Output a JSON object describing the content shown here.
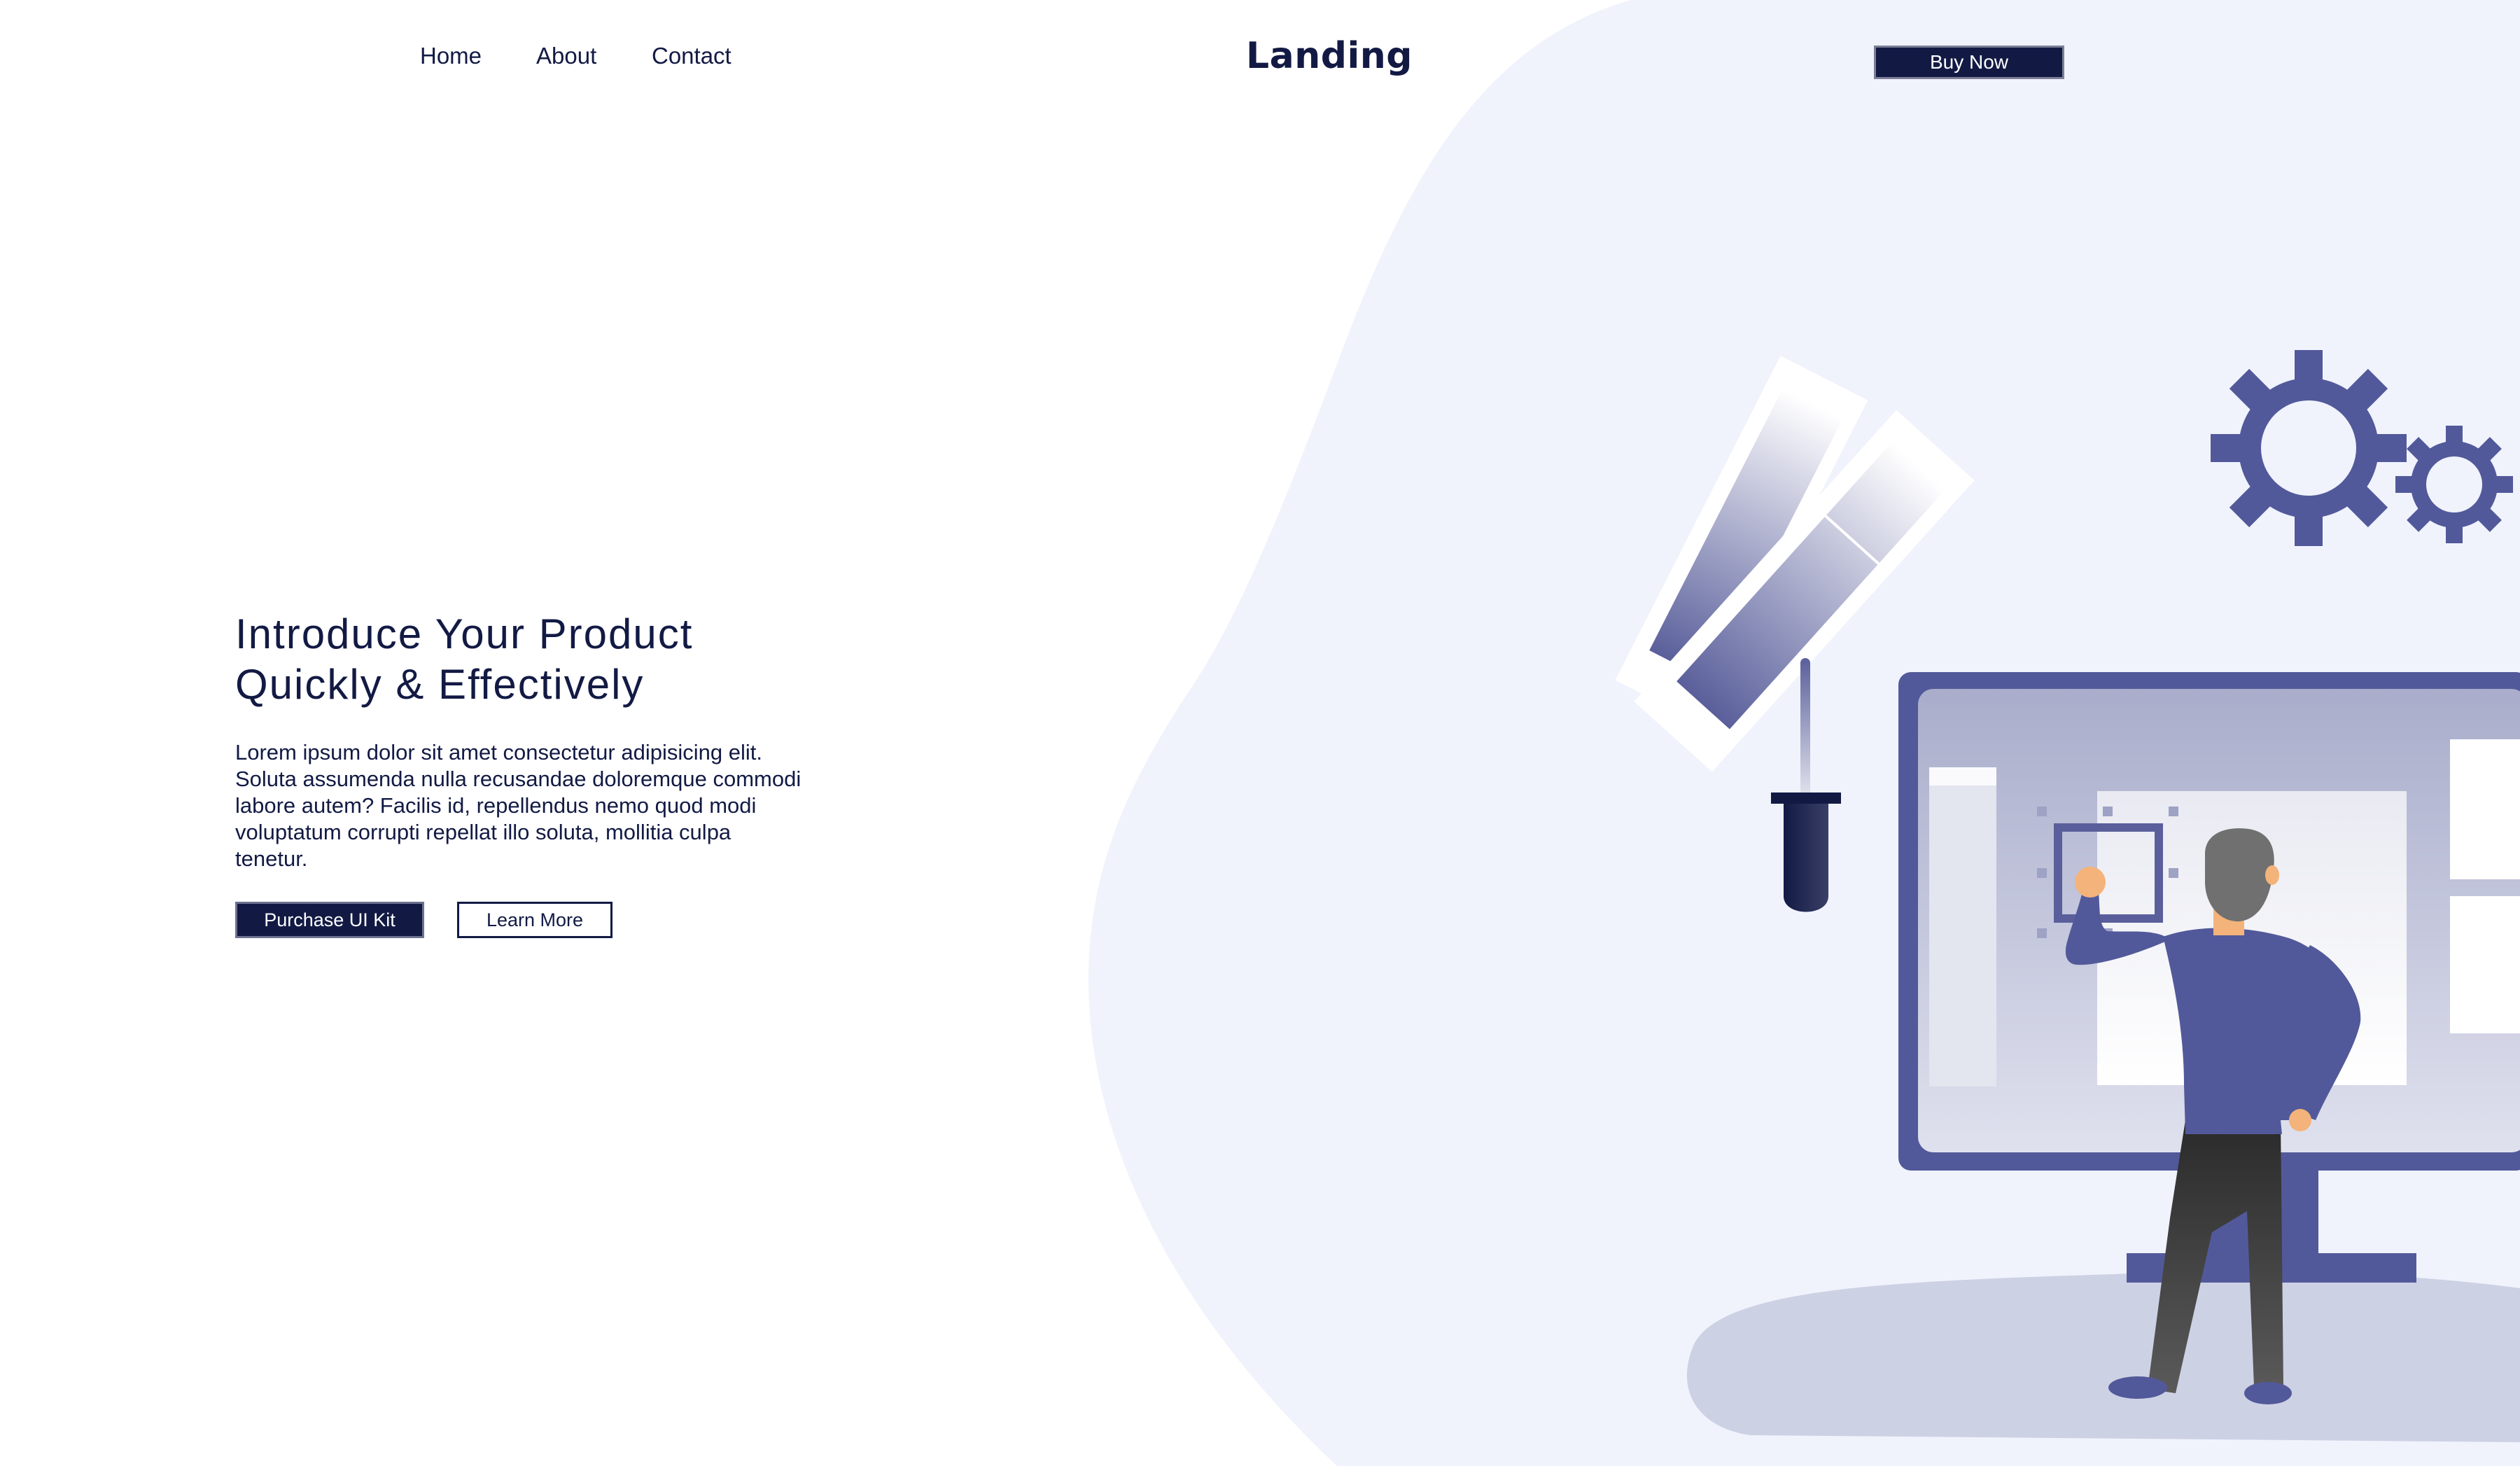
{
  "nav": {
    "links": [
      {
        "label": "Home"
      },
      {
        "label": "About"
      },
      {
        "label": "Contact"
      }
    ],
    "logo_text": "Landing",
    "cta_label": "Buy Now"
  },
  "hero": {
    "title_line1": "Introduce Your Product",
    "title_line2": "Quickly & Effectively",
    "body": "Lorem ipsum dolor sit amet consectetur adipisicing elit. Soluta assumenda nulla recusandae doloremque commodi labore autem? Facilis id, repellendus nemo quod modi voluptatum corrupti repellat illo soluta, mollitia culpa tenetur.",
    "primary_button": "Purchase UI Kit",
    "secondary_button": "Learn More"
  },
  "illustration": {
    "icons": [
      "large-gear-icon",
      "small-gear-icon",
      "color-swatch-icon",
      "eyedropper-icon",
      "monitor-icon",
      "person-figure"
    ]
  },
  "colors": {
    "brand_navy": "#121a44",
    "accent_blue": "#5a5f9b",
    "blob_bg": "#f0f3fc",
    "floor_shadow": "#cdd1e4",
    "white": "#ffffff"
  }
}
